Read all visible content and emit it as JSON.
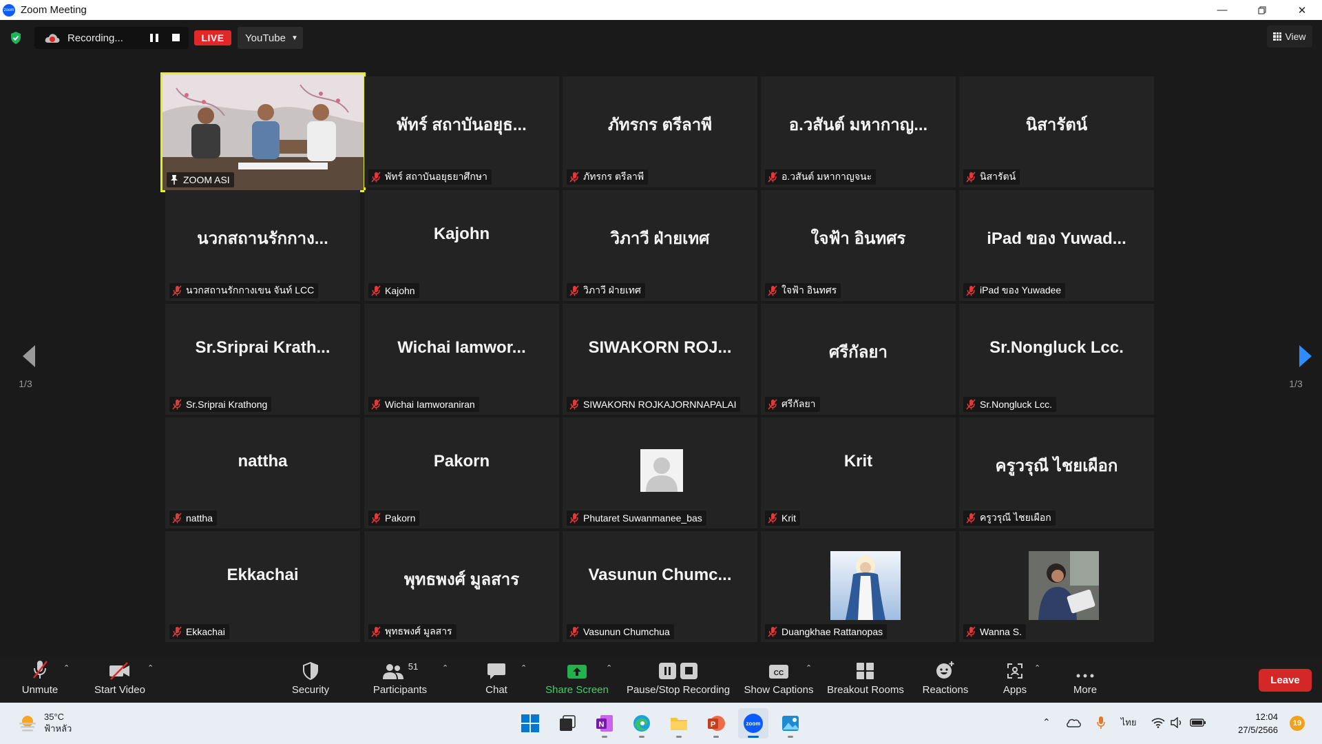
{
  "window": {
    "title": "Zoom Meeting"
  },
  "topbar": {
    "recording_label": "Recording...",
    "live_label": "LIVE",
    "stream_target": "YouTube",
    "view_label": "View"
  },
  "pager": {
    "left_page": "1/3",
    "right_page": "1/3"
  },
  "tiles": [
    {
      "big": "",
      "label": "ZOOM ASI",
      "type": "video",
      "active": true
    },
    {
      "big": "พัทร์ สถาบันอยุธ...",
      "label": "พัทร์ สถาบันอยุธยาศึกษา"
    },
    {
      "big": "ภัทรกร ตรีลาพี",
      "label": "ภัทรกร ตรีลาพี"
    },
    {
      "big": "อ.วสันต์ มหากาญ...",
      "label": "อ.วสันต์ มหากาญจนะ"
    },
    {
      "big": "นิสารัตน์",
      "label": "นิสารัตน์"
    },
    {
      "big": "นวกสถานรักกาง...",
      "label": "นวกสถานรักกางเขน จันท์ LCC"
    },
    {
      "big": "Kajohn",
      "label": "Kajohn"
    },
    {
      "big": "วิภาวี ฝ่ายเทศ",
      "label": "วิภาวี ฝ่ายเทศ"
    },
    {
      "big": "ใจฟ้า อินทศร",
      "label": "ใจฟ้า อินทศร"
    },
    {
      "big": "iPad ของ Yuwad...",
      "label": "iPad ของ Yuwadee"
    },
    {
      "big": "Sr.Sriprai  Krath...",
      "label": "Sr.Sriprai Krathong"
    },
    {
      "big": "Wichai   Iamwor...",
      "label": "Wichai  Iamworaniran"
    },
    {
      "big": "SIWAKORN  ROJ...",
      "label": "SIWAKORN ROJKAJORNNAPALAI"
    },
    {
      "big": "ศรีกัลยา",
      "label": "ศรีกัลยา"
    },
    {
      "big": "Sr.Nongluck Lcc.",
      "label": "Sr.Nongluck Lcc."
    },
    {
      "big": "nattha",
      "label": "nattha"
    },
    {
      "big": "Pakorn",
      "label": "Pakorn"
    },
    {
      "big": "",
      "label": "Phutaret Suwanmanee_bas",
      "type": "avatar-default"
    },
    {
      "big": "Krit",
      "label": "Krit"
    },
    {
      "big": "ครูวรุณี ไชยเผือก",
      "label": "ครูวรุณี ไชยเผือก"
    },
    {
      "big": "Ekkachai",
      "label": "Ekkachai"
    },
    {
      "big": "พุทธพงศ์ มูลสาร",
      "label": "พุทธพงศ์ มูลสาร"
    },
    {
      "big": "Vasunun  Chumc...",
      "label": "Vasunun Chumchua"
    },
    {
      "big": "",
      "label": "Duangkhae Rattanopas",
      "type": "photo-mary"
    },
    {
      "big": "",
      "label": "Wanna S.",
      "type": "photo-wanna"
    }
  ],
  "toolbar": {
    "unmute": "Unmute",
    "start_video": "Start Video",
    "security": "Security",
    "participants": "Participants",
    "participants_count": "51",
    "chat": "Chat",
    "share_screen": "Share Screen",
    "pause_stop": "Pause/Stop Recording",
    "show_captions": "Show Captions",
    "breakout": "Breakout Rooms",
    "reactions": "Reactions",
    "apps": "Apps",
    "more": "More",
    "leave": "Leave"
  },
  "taskbar": {
    "temp": "35°C",
    "weather_desc": "ฟ้าหลัว",
    "lang": "ไทย",
    "time": "12:04",
    "date": "27/5/2566",
    "notif_count": "19"
  },
  "colors": {
    "active_speaker": "#e5f01e",
    "share_green": "#3ed16a",
    "leave_red": "#d42727",
    "live_red": "#e02828"
  }
}
